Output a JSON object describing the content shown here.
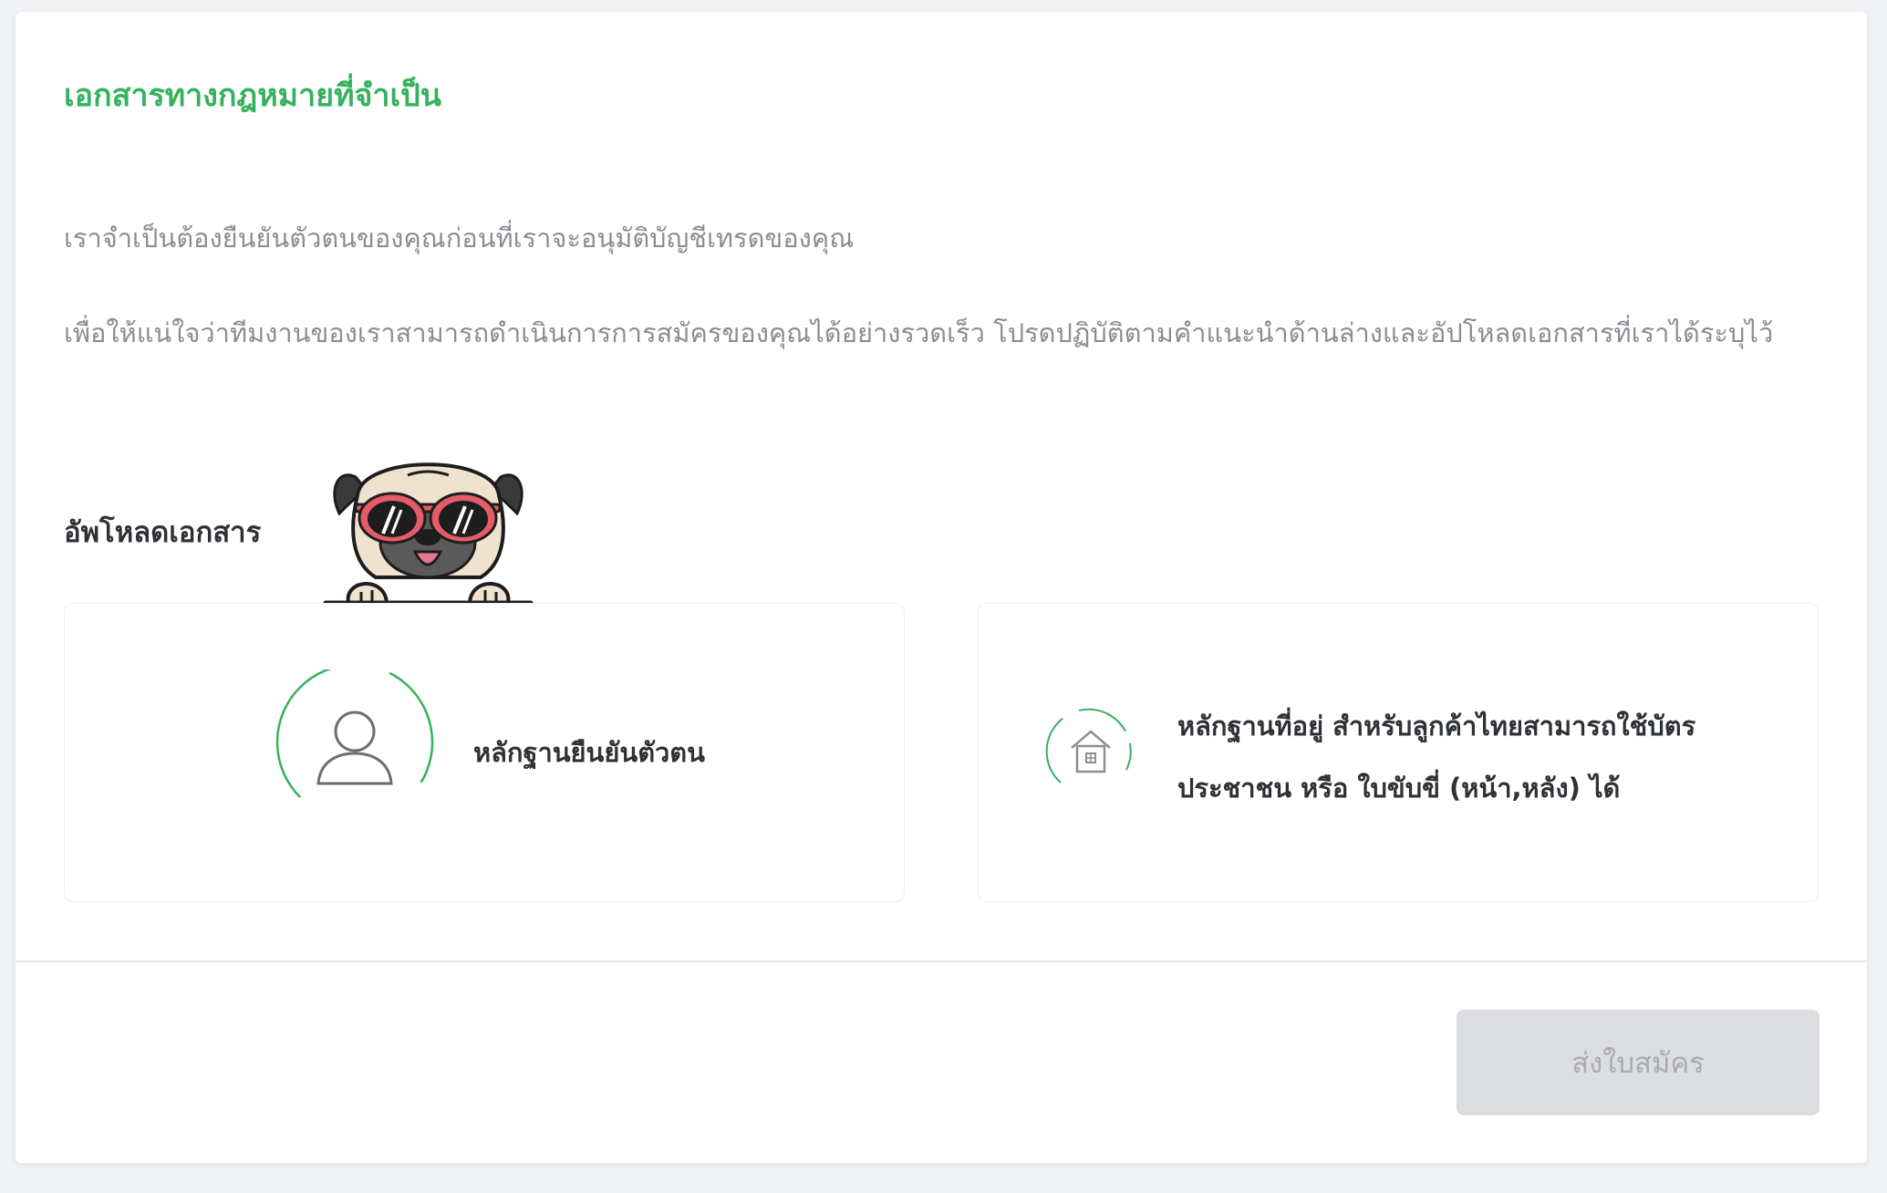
{
  "header": {
    "title": "เอกสารทางกฎหมายที่จำเป็น"
  },
  "intro": {
    "line1": "เราจำเป็นต้องยืนยันตัวตนของคุณก่อนที่เราจะอนุมัติบัญชีเทรดของคุณ",
    "line2": "เพื่อให้แน่ใจว่าทีมงานของเราสามารถดำเนินการการสมัครของคุณได้อย่างรวดเร็ว โปรดปฏิบัติตามคำแนะนำด้านล่างและอัปโหลดเอกสารที่เราได้ระบุไว้"
  },
  "upload": {
    "section_title": "อัพโหลดเอกสาร",
    "identity_label": "หลักฐานยืนยันตัวตน",
    "address_label": "หลักฐานที่อยู่ สำหรับลูกค้าไทยสามารถใช้บัตรประชาชน หรือ ใบขับขี่ (หน้า,หลัง) ได้"
  },
  "footer": {
    "submit_label": "ส่งใบสมัคร"
  },
  "colors": {
    "accent": "#34b25c",
    "disabled_bg": "#dcdde0",
    "disabled_text": "#a9abaf"
  },
  "icons": {
    "identity": "user-icon",
    "address": "house-icon",
    "mascot": "pug-mascot"
  }
}
